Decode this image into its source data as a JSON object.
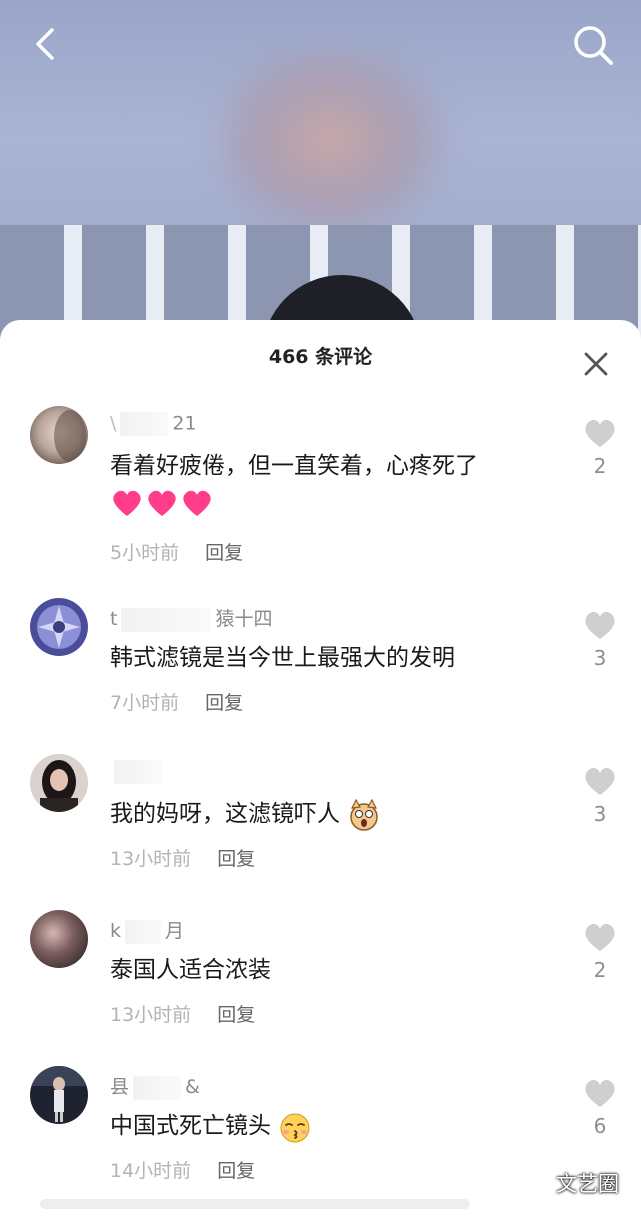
{
  "header": {
    "back_icon": "chevron-left-icon",
    "search_icon": "search-icon"
  },
  "sheet": {
    "title": "466 条评论",
    "close_icon": "close-icon"
  },
  "comments": [
    {
      "username_suffix": "21",
      "text": "看着好疲倦，但一直笑着，心疼死了",
      "emoji": "pink-hearts",
      "time": "5小时前",
      "reply": "回复",
      "likes": "2"
    },
    {
      "username_prefix": "t",
      "username_suffix": "猿十四",
      "text": "韩式滤镜是当今世上最强大的发明",
      "time": "7小时前",
      "reply": "回复",
      "likes": "3"
    },
    {
      "username_suffix": "",
      "text": "我的妈呀，这滤镜吓人",
      "emoji": "scared-cat",
      "time": "13小时前",
      "reply": "回复",
      "likes": "3"
    },
    {
      "username_prefix": "k",
      "username_suffix": "月",
      "text": "泰国人适合浓装",
      "time": "13小时前",
      "reply": "回复",
      "likes": "2"
    },
    {
      "username_prefix": "县",
      "username_suffix": "&",
      "text": "中国式死亡镜头",
      "emoji": "kissing-face",
      "time": "14小时前",
      "reply": "回复",
      "likes": "6"
    }
  ],
  "watermark": "文艺圈",
  "colors": {
    "heart_pink": "#ff3d8b",
    "like_gray": "#cfcfcf",
    "meta_gray": "#b3b3b3"
  }
}
